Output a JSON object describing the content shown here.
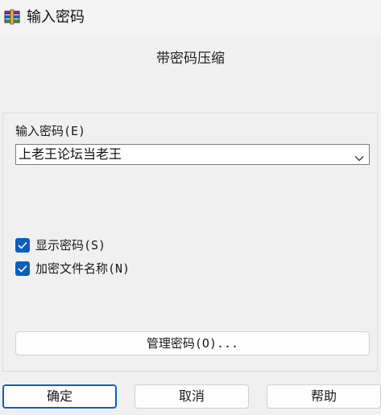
{
  "window": {
    "title": "输入密码",
    "app_icon": "winrar-books-icon"
  },
  "header": {
    "subtitle": "带密码压缩"
  },
  "password": {
    "label": "输入密码(E)",
    "value": "上老王论坛当老王"
  },
  "options": {
    "show_password": {
      "label": "显示密码(S)",
      "checked": true
    },
    "encrypt_filenames": {
      "label": "加密文件名称(N)",
      "checked": true
    }
  },
  "buttons": {
    "manage": "管理密码(O)...",
    "ok": "确定",
    "cancel": "取消",
    "help": "帮助"
  },
  "colors": {
    "accent": "#0a5fbf",
    "background": "#f0f0f0"
  }
}
